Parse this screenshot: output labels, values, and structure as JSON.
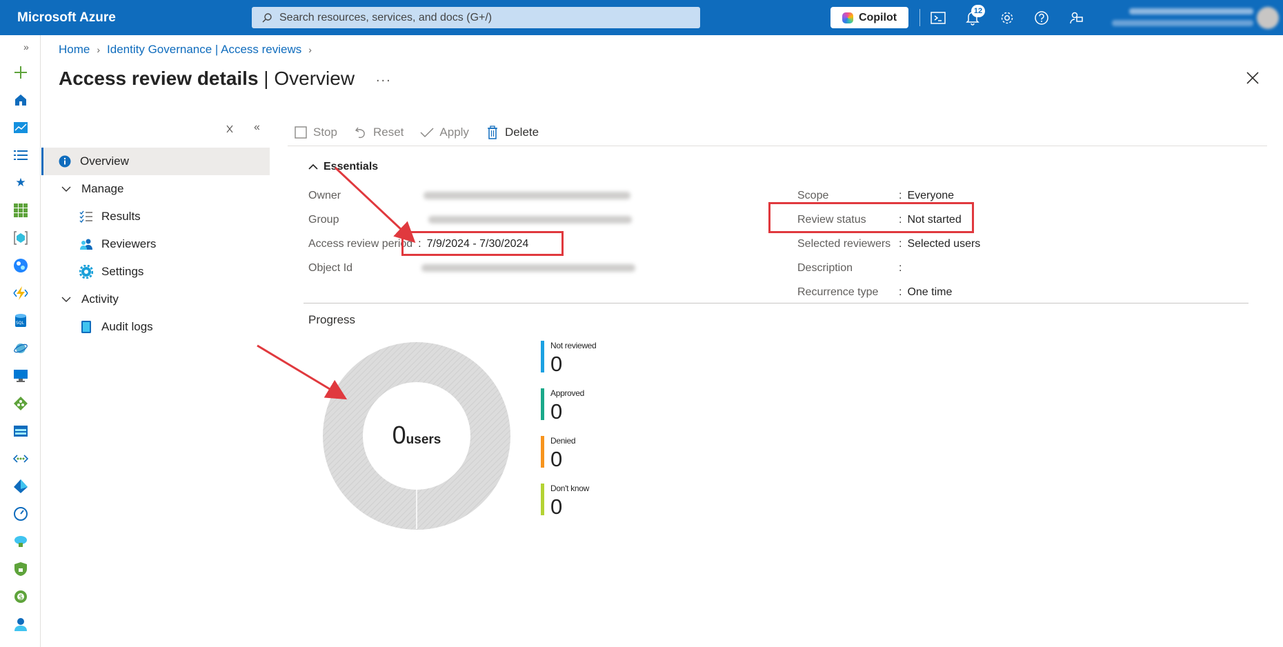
{
  "topbar": {
    "brand": "Microsoft Azure",
    "search_placeholder": "Search resources, services, and docs (G+/)",
    "copilot_label": "Copilot",
    "notification_count": "12",
    "color": "#0f6cbd"
  },
  "breadcrumb": {
    "items": [
      "Home",
      "Identity Governance | Access reviews"
    ]
  },
  "page": {
    "title_bold": "Access review details",
    "title_sep": "|",
    "title_rest": "Overview",
    "more": "..."
  },
  "nav": {
    "items": [
      {
        "label": "Overview",
        "icon": "info-icon",
        "active": true
      },
      {
        "label": "Manage",
        "icon": "chevron-down-icon",
        "group": true
      },
      {
        "label": "Results",
        "icon": "checklist-icon"
      },
      {
        "label": "Reviewers",
        "icon": "people-icon"
      },
      {
        "label": "Settings",
        "icon": "gear-icon"
      },
      {
        "label": "Activity",
        "icon": "chevron-down-icon",
        "group": true
      },
      {
        "label": "Audit logs",
        "icon": "book-icon"
      }
    ]
  },
  "commands": {
    "stop": "Stop",
    "reset": "Reset",
    "apply": "Apply",
    "delete": "Delete"
  },
  "essentials": {
    "title": "Essentials",
    "left": [
      {
        "label": "Owner",
        "value": ""
      },
      {
        "label": "Group",
        "value": ""
      },
      {
        "label": "Access review period",
        "value": "7/9/2024 - 7/30/2024"
      },
      {
        "label": "Object Id",
        "value": ""
      }
    ],
    "right": [
      {
        "label": "Scope",
        "value": "Everyone"
      },
      {
        "label": "Review status",
        "value": "Not started"
      },
      {
        "label": "Selected reviewers",
        "value": "Selected users"
      },
      {
        "label": "Description",
        "value": ""
      },
      {
        "label": "Recurrence type",
        "value": "One time"
      }
    ]
  },
  "progress": {
    "title": "Progress",
    "total": "0",
    "unit": "users",
    "legend": [
      {
        "label": "Not reviewed",
        "value": "0",
        "color": "#1ba1e2"
      },
      {
        "label": "Approved",
        "value": "0",
        "color": "#1aa98a"
      },
      {
        "label": "Denied",
        "value": "0",
        "color": "#f7941d"
      },
      {
        "label": "Don't know",
        "value": "0",
        "color": "#b4d334"
      }
    ]
  },
  "annotation_color": "#e0393e"
}
